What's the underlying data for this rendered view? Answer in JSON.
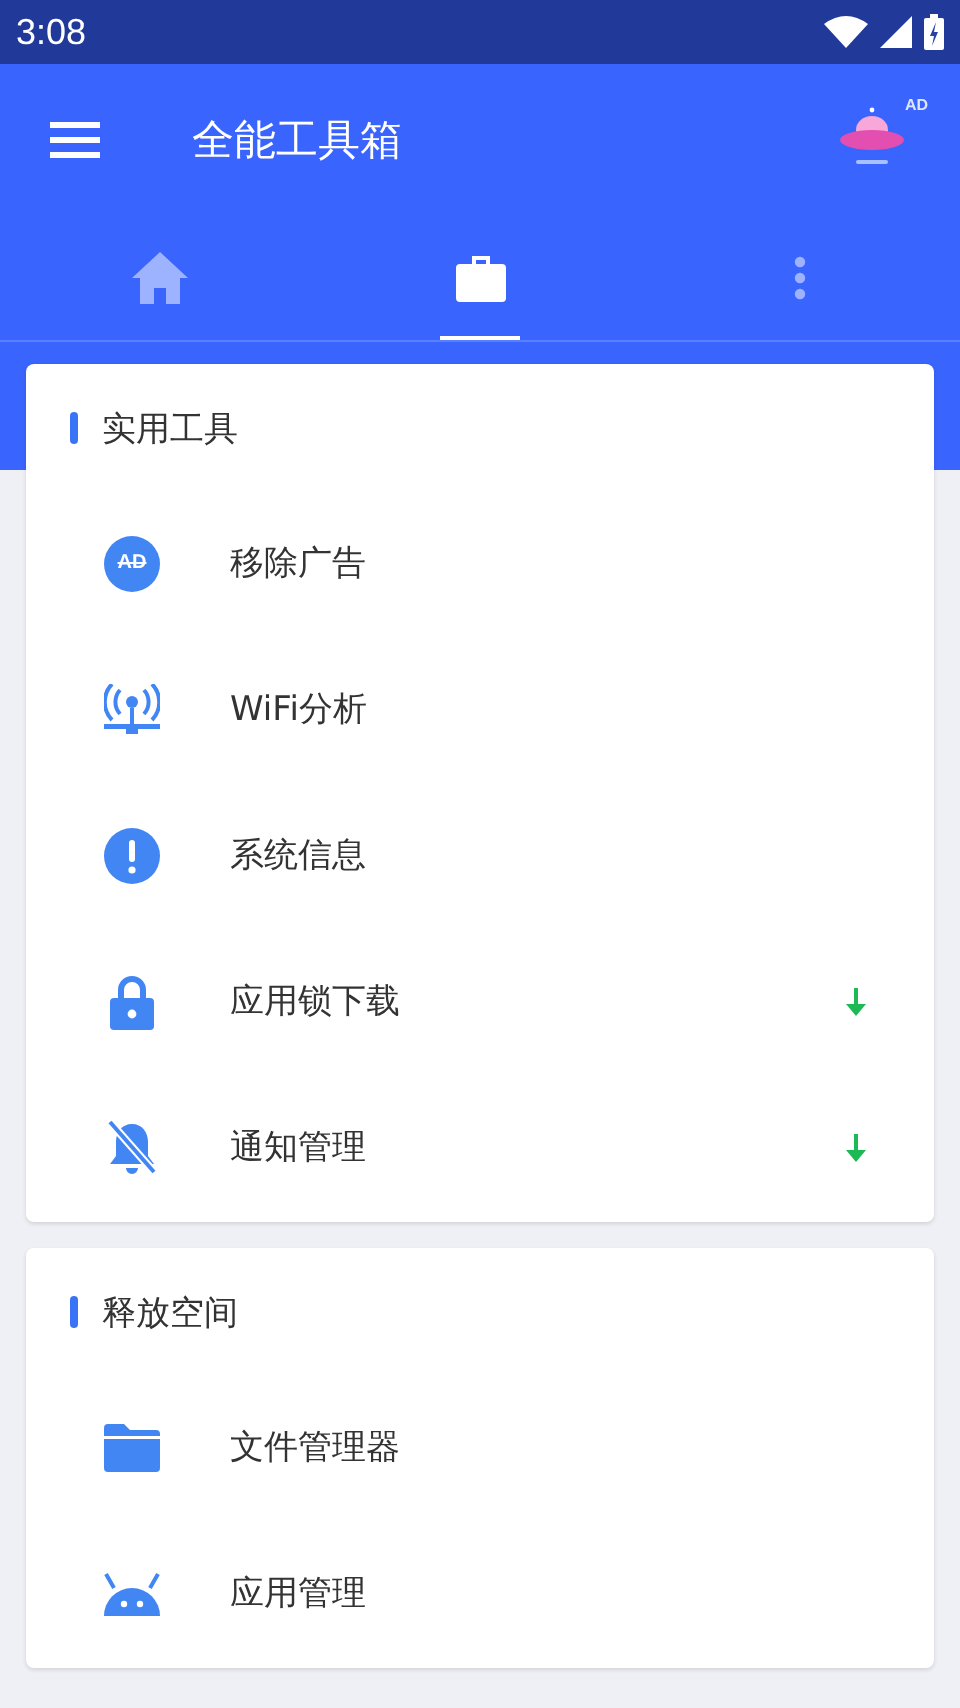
{
  "status_bar": {
    "time": "3:08"
  },
  "app_bar": {
    "title": "全能工具箱",
    "ad_badge": "AD"
  },
  "tabs": [
    {
      "kind": "home",
      "selected": false
    },
    {
      "kind": "toolbox",
      "selected": true
    },
    {
      "kind": "more",
      "selected": false
    }
  ],
  "sections": [
    {
      "title": "实用工具",
      "items": [
        {
          "kind": "ad",
          "icon_text": "AD",
          "label": "移除广告",
          "download": false
        },
        {
          "kind": "wifi",
          "label": "WiFi分析",
          "download": false
        },
        {
          "kind": "info",
          "label": "系统信息",
          "download": false
        },
        {
          "kind": "lock",
          "label": "应用锁下载",
          "download": true
        },
        {
          "kind": "bell-off",
          "label": "通知管理",
          "download": true
        }
      ]
    },
    {
      "title": "释放空间",
      "items": [
        {
          "kind": "folder",
          "label": "文件管理器",
          "download": false
        },
        {
          "kind": "android",
          "label": "应用管理",
          "download": false
        }
      ]
    }
  ]
}
